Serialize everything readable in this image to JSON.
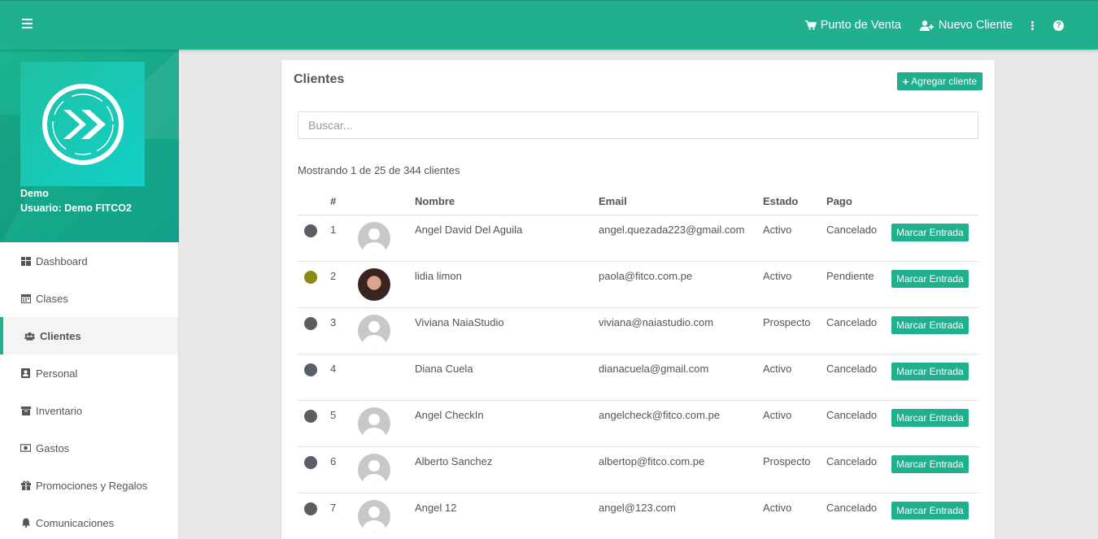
{
  "topbar": {
    "pos_label": "Punto de Venta",
    "new_client_label": "Nuevo Cliente",
    "accent": "#20b08e"
  },
  "sidebar": {
    "profile": {
      "name": "Demo",
      "user": "Usuario: Demo FITCO2"
    },
    "items": [
      {
        "label": "Dashboard",
        "icon": "dashboard-icon"
      },
      {
        "label": "Clases",
        "icon": "calendar-icon"
      },
      {
        "label": "Clientes",
        "icon": "users-icon",
        "active": true
      },
      {
        "label": "Personal",
        "icon": "address-book-icon"
      },
      {
        "label": "Inventario",
        "icon": "archive-icon"
      },
      {
        "label": "Gastos",
        "icon": "money-icon"
      },
      {
        "label": "Promociones y Regalos",
        "icon": "gift-icon"
      },
      {
        "label": "Comunicaciones",
        "icon": "bell-icon"
      }
    ]
  },
  "main": {
    "title": "Clientes",
    "add_button": "Agregar cliente",
    "search_placeholder": "Buscar...",
    "showing": "Mostrando 1 de 25 de 344 clientes",
    "columns": [
      "#",
      "Nombre",
      "Email",
      "Estado",
      "Pago"
    ],
    "action_label": "Marcar Entrada",
    "rows": [
      {
        "num": "1",
        "name": "Angel David Del Aguila",
        "email": "angel.quezada223@gmail.com",
        "status": "Activo",
        "payment": "Cancelado",
        "dot_color": "#5a5f66",
        "avatar": "default"
      },
      {
        "num": "2",
        "name": "lidia limon",
        "email": "paola@fitco.com.pe",
        "status": "Activo",
        "payment": "Pendiente",
        "dot_color": "#8a8a10",
        "avatar": "photo"
      },
      {
        "num": "3",
        "name": "Viviana NaiaStudio",
        "email": "viviana@naiastudio.com",
        "status": "Prospecto",
        "payment": "Cancelado",
        "dot_color": "#5a5f66",
        "avatar": "default"
      },
      {
        "num": "4",
        "name": "Diana Cuela",
        "email": "dianacuela@gmail.com",
        "status": "Activo",
        "payment": "Cancelado",
        "dot_color": "#5a5f66",
        "avatar": "none"
      },
      {
        "num": "5",
        "name": "Angel CheckIn",
        "email": "angelcheck@fitco.com.pe",
        "status": "Activo",
        "payment": "Cancelado",
        "dot_color": "#5a5f66",
        "avatar": "default"
      },
      {
        "num": "6",
        "name": "Alberto Sanchez",
        "email": "albertop@fitco.com.pe",
        "status": "Prospecto",
        "payment": "Cancelado",
        "dot_color": "#5a5f66",
        "avatar": "default"
      },
      {
        "num": "7",
        "name": "Angel 12",
        "email": "angel@123.com",
        "status": "Activo",
        "payment": "Cancelado",
        "dot_color": "#5a5f66",
        "avatar": "default"
      }
    ]
  }
}
